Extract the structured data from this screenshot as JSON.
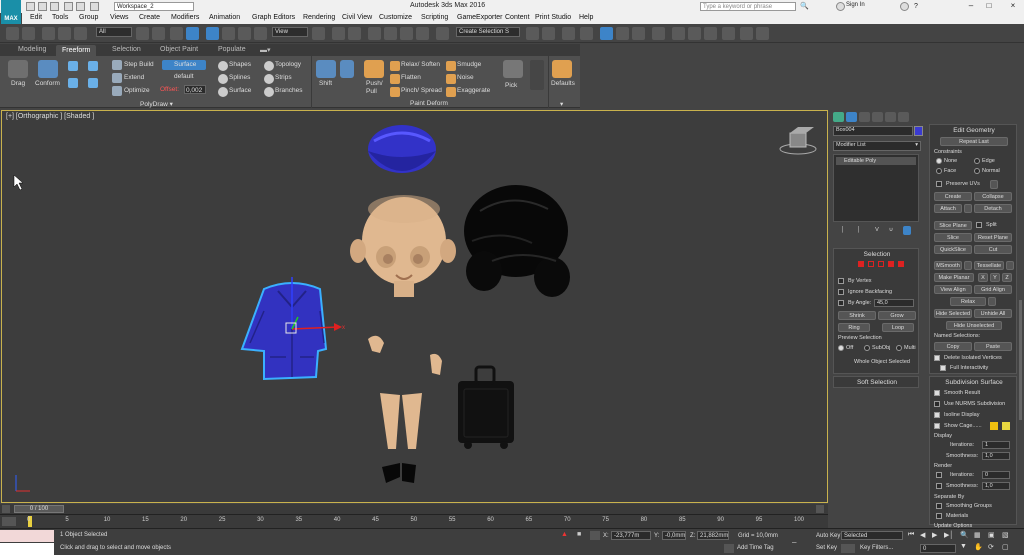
{
  "app": {
    "title": "Autodesk 3ds Max 2016",
    "logo_text": "MAX",
    "workspace": "Workspace_2",
    "search_placeholder": "Type a keyword or phrase",
    "sign_in": "Sign In"
  },
  "menu": [
    "Edit",
    "Tools",
    "Group",
    "Views",
    "Create",
    "Modifiers",
    "Animation",
    "Graph Editors",
    "Rendering",
    "Civil View",
    "Customize",
    "Scripting",
    "GameExporter",
    "Content",
    "Print Studio",
    "Help"
  ],
  "toolbar": {
    "filter": "All",
    "ref_coord": "View",
    "selection_set": "Create Selection S"
  },
  "ribbon": {
    "tabs": [
      "Modeling",
      "Freeform",
      "Selection",
      "Object Paint",
      "Populate"
    ],
    "active_tab": "Freeform",
    "drag": "Drag",
    "conform": "Conform",
    "step_build": "Step Build",
    "extend": "Extend",
    "optimize": "Optimize",
    "surface_btn": "Surface",
    "default_label": "default",
    "offset_label": "Offset:",
    "offset_value": "0,002",
    "shapes": "Shapes",
    "splines": "Splines",
    "surface": "Surface",
    "topology": "Topology",
    "strips": "Strips",
    "branches": "Branches",
    "shift": "Shift",
    "push_pull": "Push/ Pull",
    "relax_soften": "Relax/ Soften",
    "flatten": "Flatten",
    "pinch_spread": "Pinch/ Spread",
    "smudge": "Smudge",
    "noise": "Noise",
    "exaggerate": "Exaggerate",
    "pick": "Pick",
    "defaults": "Defaults",
    "panel_polydraw": "PolyDraw",
    "panel_paint_deform": "Paint Deform"
  },
  "viewport": {
    "label": "[+] [Orthographic ] [Shaded ]",
    "axis_x": "x"
  },
  "command_panel": {
    "object_name": "Box004",
    "modifier_list": "Modifier List",
    "stack_item": "Editable Poly",
    "selection": {
      "title": "Selection",
      "by_vertex": "By Vertex",
      "ignore_backfacing": "Ignore Backfacing",
      "by_angle": "By Angle:",
      "angle_value": "45,0",
      "shrink": "Shrink",
      "grow": "Grow",
      "ring": "Ring",
      "loop": "Loop",
      "preview_selection": "Preview Selection",
      "off": "Off",
      "subobj": "SubObj",
      "multi": "Multi",
      "whole_object": "Whole Object Selected"
    },
    "soft_selection": "Soft Selection",
    "edit_geometry": {
      "title": "Edit Geometry",
      "repeat_last": "Repeat Last",
      "constraints": "Constraints",
      "none": "None",
      "edge": "Edge",
      "face": "Face",
      "normal": "Normal",
      "preserve_uvs": "Preserve UVs",
      "create": "Create",
      "collapse": "Collapse",
      "attach": "Attach",
      "detach": "Detach",
      "slice_plane": "Slice Plane",
      "split": "Split",
      "slice": "Slice",
      "reset_plane": "Reset Plane",
      "quickslice": "QuickSlice",
      "cut": "Cut",
      "msmooth": "MSmooth",
      "tessellate": "Tessellate",
      "make_planar": "Make Planar",
      "x": "X",
      "y": "Y",
      "z": "Z",
      "view_align": "View Align",
      "grid_align": "Grid Align",
      "relax": "Relax",
      "hide_selected": "Hide Selected",
      "unhide_all": "Unhide All",
      "hide_unselected": "Hide Unselected",
      "named_selections": "Named Selections:",
      "copy": "Copy",
      "paste": "Paste",
      "delete_isolated": "Delete Isolated Vertices",
      "full_interactivity": "Full Interactivity"
    },
    "subdivision": {
      "title": "Subdivision Surface",
      "smooth_result": "Smooth Result",
      "use_nurms": "Use NURMS Subdivision",
      "isoline_display": "Isoline Display",
      "show_cage": "Show Cage......",
      "display": "Display",
      "iterations_label": "Iterations:",
      "iterations": "1",
      "smoothness_label": "Smoothness:",
      "smoothness": "1,0",
      "render": "Render",
      "r_iterations": "0",
      "r_smoothness": "1,0",
      "separate_by": "Separate By",
      "smoothing_groups": "Smoothing Groups",
      "materials": "Materials",
      "update_options": "Update Options"
    }
  },
  "timeline": {
    "frame": "0 / 100",
    "ticks": [
      "0",
      "5",
      "10",
      "15",
      "20",
      "25",
      "30",
      "35",
      "40",
      "45",
      "50",
      "55",
      "60",
      "65",
      "70",
      "75",
      "80",
      "85",
      "90",
      "95",
      "100"
    ]
  },
  "status": {
    "objects_selected": "1 Object Selected",
    "prompt": "Click and drag to select and move objects",
    "x_label": "X:",
    "x": "-23,777m",
    "y_label": "Y:",
    "y": "-0,0mm",
    "z_label": "Z:",
    "z": "21,882mm",
    "grid": "Grid = 10,0mm",
    "add_time_tag": "Add Time Tag",
    "auto_key": "Auto Key",
    "selected": "Selected",
    "set_key": "Set Key",
    "key_filters": "Key Filters...",
    "frame_value": "0"
  },
  "colors": {
    "accent": "#3d84c8",
    "selection": "#3a3ad0",
    "viewport_border": "#c9b24d",
    "cage1": "#f0c010",
    "cage2": "#e8d840"
  }
}
